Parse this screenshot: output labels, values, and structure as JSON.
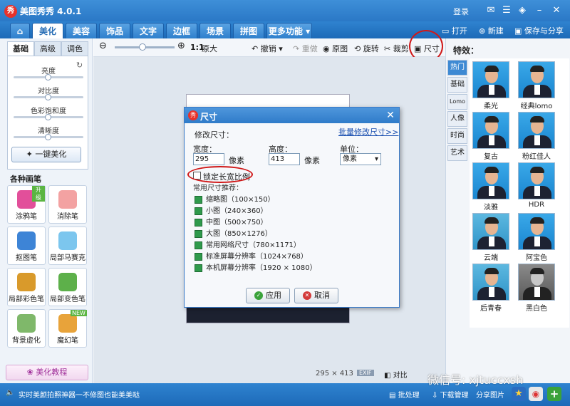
{
  "app": {
    "title": "美图秀秀 4.0.1",
    "logo_char": "秀",
    "login": "登录"
  },
  "tabs": [
    {
      "label": "美化"
    },
    {
      "label": "美容"
    },
    {
      "label": "饰品"
    },
    {
      "label": "文字"
    },
    {
      "label": "边框"
    },
    {
      "label": "场景"
    },
    {
      "label": "拼图"
    },
    {
      "label": "更多功能 ▾"
    }
  ],
  "file_actions": {
    "open": "打开",
    "new": "新建",
    "save_share": "保存与分享"
  },
  "left": {
    "subtabs": [
      "基础",
      "高级",
      "调色"
    ],
    "sliders": [
      {
        "label": "亮度",
        "level": 0.5
      },
      {
        "label": "对比度",
        "level": 0.5
      },
      {
        "label": "色彩饱和度",
        "level": 0.5
      },
      {
        "label": "清晰度",
        "level": 0.5
      }
    ],
    "one_click": "一键美化",
    "brushes_title": "各种画笔",
    "brushes": [
      {
        "label": "涂鸦笔",
        "badge": "升级",
        "color": "#e24f9a"
      },
      {
        "label": "消除笔",
        "badge": "",
        "color": "#f3a2a2"
      },
      {
        "label": "抠图笔",
        "badge": "",
        "color": "#3d84d6"
      },
      {
        "label": "局部马赛克",
        "badge": "",
        "color": "#7cc6ee"
      },
      {
        "label": "局部彩色笔",
        "badge": "",
        "color": "#d99a2b"
      },
      {
        "label": "局部变色笔",
        "badge": "",
        "color": "#5db04a"
      },
      {
        "label": "背景虚化",
        "badge": "",
        "color": "#7fb86a"
      },
      {
        "label": "魔幻笔",
        "badge": "NEW",
        "color": "#e8a33a"
      }
    ],
    "tutorial": "美化教程"
  },
  "toolbar": {
    "zoom_ratio": "1:1",
    "original_size": "原大",
    "undo": "撤销",
    "redo": "重做",
    "original": "原图",
    "rotate": "旋转",
    "crop": "裁剪",
    "size": "尺寸"
  },
  "canvas": {
    "dims": "295 × 413",
    "exif": "EXIF",
    "compare": "对比"
  },
  "dialog": {
    "title": "尺寸",
    "modify_label": "修改尺寸：",
    "batch_link": "批量修改尺寸>>",
    "width_label": "宽度：",
    "width_value": "295",
    "height_label": "高度：",
    "height_value": "413",
    "pixel_unit": "像素",
    "unit_label": "单位：",
    "unit_value": "像素",
    "lock_ratio": "锁定长宽比例",
    "common_sizes": "常用尺寸推荐：",
    "presets": [
      "缩略图（100×150）",
      "小图（240×360）",
      "中图（500×750）",
      "大图（850×1276）",
      "常用网络尺寸（780×1171）",
      "标准屏幕分辨率（1024×768）",
      "本机屏幕分辨率（1920 × 1080）"
    ],
    "apply": "应用",
    "cancel": "取消"
  },
  "right": {
    "title": "特效：",
    "categories": [
      "热门",
      "基础",
      "Lomo",
      "人像",
      "时尚",
      "艺术"
    ],
    "effects": [
      {
        "label": "柔光",
        "style": "normal"
      },
      {
        "label": "经典lomo",
        "style": "normal"
      },
      {
        "label": "复古",
        "style": "normal"
      },
      {
        "label": "粉红佳人",
        "style": "normal"
      },
      {
        "label": "淡雅",
        "style": "normal"
      },
      {
        "label": "HDR",
        "style": "normal"
      },
      {
        "label": "云端",
        "style": "warm"
      },
      {
        "label": "阿宝色",
        "style": "normal"
      },
      {
        "label": "后青春",
        "style": "warm"
      },
      {
        "label": "黑白色",
        "style": "bw"
      }
    ]
  },
  "statusbar": {
    "tip": "实时美颜拍照神器一不修图也能美美哒",
    "batch": "批处理",
    "download": "下载管理",
    "share_pic": "分享图片"
  },
  "watermark": "微信号: xjtuccxsh"
}
